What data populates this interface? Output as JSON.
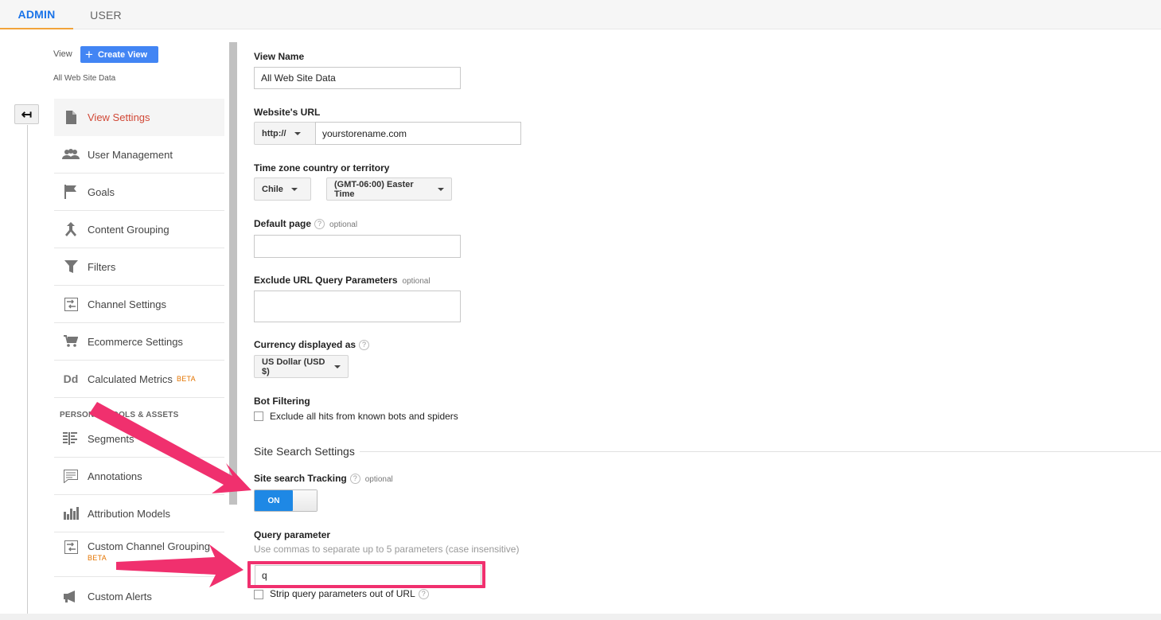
{
  "tabs": {
    "admin": "ADMIN",
    "user": "USER"
  },
  "sidebar": {
    "view_label": "View",
    "create_view": "Create View",
    "view_name": "All Web Site Data",
    "items": [
      {
        "label": "View Settings",
        "icon": "document-icon"
      },
      {
        "label": "User Management",
        "icon": "people-icon"
      },
      {
        "label": "Goals",
        "icon": "flag-icon"
      },
      {
        "label": "Content Grouping",
        "icon": "merge-icon"
      },
      {
        "label": "Filters",
        "icon": "filter-icon"
      },
      {
        "label": "Channel Settings",
        "icon": "channel-icon"
      },
      {
        "label": "Ecommerce Settings",
        "icon": "cart-icon"
      },
      {
        "label": "Calculated Metrics",
        "icon": "dd-icon",
        "badge": "BETA"
      }
    ],
    "section_header": "PERSONAL TOOLS & ASSETS",
    "tools": [
      {
        "label": "Segments",
        "icon": "segments-icon"
      },
      {
        "label": "Annotations",
        "icon": "annotation-icon"
      },
      {
        "label": "Attribution Models",
        "icon": "bar-chart-icon"
      },
      {
        "label": "Custom Channel Grouping",
        "icon": "channel-icon",
        "badge": "BETA"
      },
      {
        "label": "Custom Alerts",
        "icon": "megaphone-icon"
      }
    ]
  },
  "form": {
    "view_name": {
      "label": "View Name",
      "value": "All Web Site Data"
    },
    "website_url": {
      "label": "Website's URL",
      "protocol": "http://",
      "value": "yourstorename.com"
    },
    "timezone": {
      "label": "Time zone country or territory",
      "country": "Chile",
      "zone": "(GMT-06:00) Easter Time"
    },
    "default_page": {
      "label": "Default page",
      "optional": "optional",
      "value": ""
    },
    "exclude_params": {
      "label": "Exclude URL Query Parameters",
      "optional": "optional",
      "value": ""
    },
    "currency": {
      "label": "Currency displayed as",
      "value": "US Dollar (USD $)"
    },
    "bot_filtering": {
      "label": "Bot Filtering",
      "checkbox_label": "Exclude all hits from known bots and spiders"
    },
    "site_search_title": "Site Search Settings",
    "site_search_tracking": {
      "label": "Site search Tracking",
      "optional": "optional",
      "toggle": "ON"
    },
    "query_parameter": {
      "label": "Query parameter",
      "hint": "Use commas to separate up to 5 parameters (case insensitive)",
      "value": "q"
    },
    "strip_params": {
      "label": "Strip query parameters out of URL"
    },
    "help_glyph": "?"
  },
  "colors": {
    "accent_blue": "#4285f4",
    "active_red": "#d14836",
    "annotation_pink": "#f0306e",
    "beta_orange": "#e37400"
  }
}
